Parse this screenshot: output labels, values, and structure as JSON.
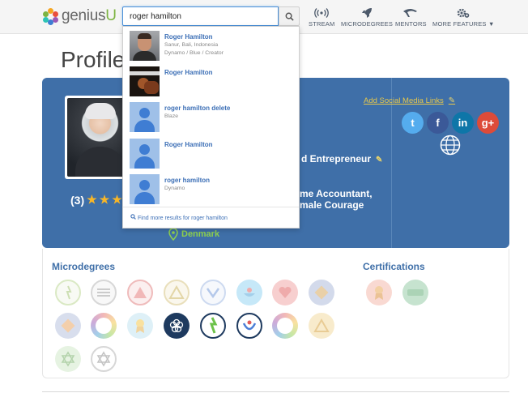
{
  "brand": {
    "name_prefix": "genius",
    "name_suffix": "U"
  },
  "search": {
    "value": "roger hamilton"
  },
  "nav": [
    {
      "label": "STREAM",
      "icon": "broadcast-icon"
    },
    {
      "label": "MICRODEGREES",
      "icon": "rocket-icon"
    },
    {
      "label": "MENTORS",
      "icon": "dolphin-icon"
    },
    {
      "label": "MORE FEATURES",
      "icon": "gear-icon"
    }
  ],
  "dropdown": {
    "results": [
      {
        "name": "Roger Hamilton",
        "line1": "Sanur, Bali, Indonesia",
        "line2": "Dynamo / Blue / Creator",
        "thumb": "photo"
      },
      {
        "name": "Roger Hamilton",
        "line1": "",
        "line2": "",
        "thumb": "photo"
      },
      {
        "name": "roger hamilton delete",
        "line1": "Blaze",
        "line2": "",
        "thumb": "placeholder"
      },
      {
        "name": "Roger Hamilton",
        "line1": "",
        "line2": "",
        "thumb": "placeholder"
      },
      {
        "name": "roger hamilton",
        "line1": "Dynamo",
        "line2": "",
        "thumb": "placeholder"
      }
    ],
    "more_results": "Find more results for roger hamilton"
  },
  "page": {
    "title": "Profile"
  },
  "profile": {
    "rating_count": "(3)",
    "stars": 3,
    "tagline_visible": "d Entrepreneur",
    "bio_line1_visible": "me Accountant,",
    "bio_line2_visible": "male Courage",
    "location": "Denmark",
    "add_social_links": "Add Social Media Links",
    "social": [
      {
        "name": "twitter",
        "glyph": "t",
        "color": "#55acee"
      },
      {
        "name": "facebook",
        "glyph": "f",
        "color": "#3b5998"
      },
      {
        "name": "linkedin",
        "glyph": "in",
        "color": "#0e76a8"
      },
      {
        "name": "google-plus",
        "glyph": "g+",
        "color": "#dd4b39"
      }
    ]
  },
  "microdegrees": {
    "title": "Microdegrees"
  },
  "certifications": {
    "title": "Certifications"
  },
  "colors": {
    "card_blue": "#3f6fa8",
    "accent_green": "#8fd14f",
    "link_blue": "#3c6fb6",
    "link_yellow": "#e8c84a"
  }
}
